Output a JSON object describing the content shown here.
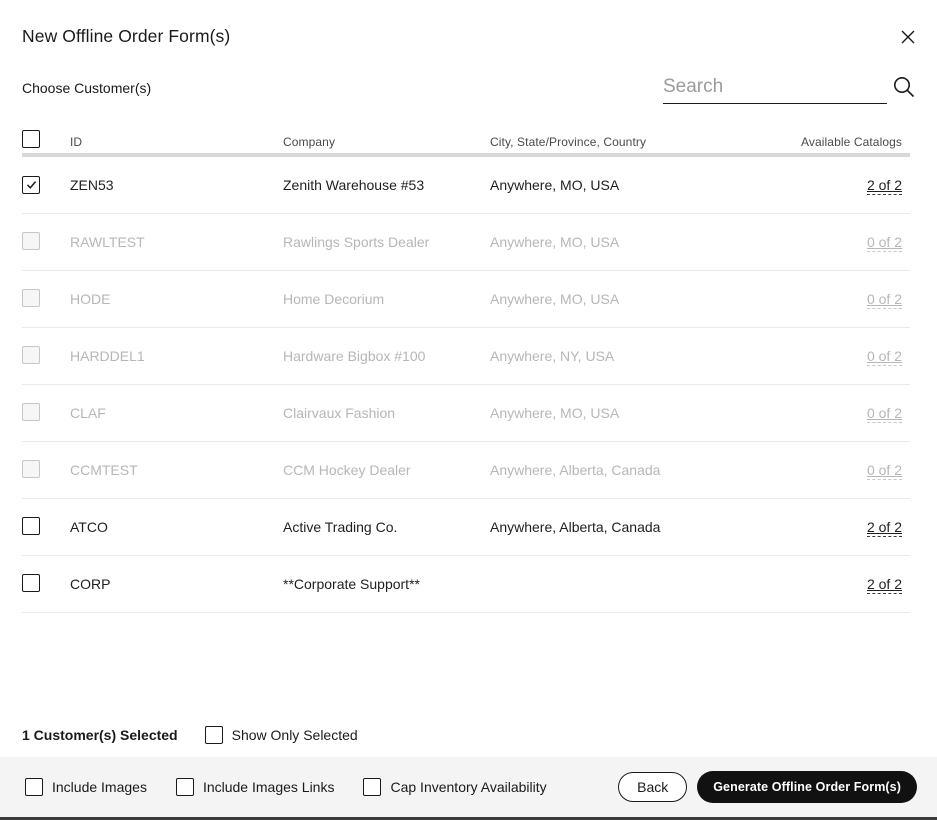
{
  "modal": {
    "title": "New Offline Order Form(s)"
  },
  "choose_label": "Choose Customer(s)",
  "search": {
    "placeholder": "Search"
  },
  "table": {
    "headers": {
      "id": "ID",
      "company": "Company",
      "city": "City, State/Province, Country",
      "catalogs": "Available Catalogs"
    },
    "rows": [
      {
        "id": "ZEN53",
        "company": "Zenith Warehouse #53",
        "city": "Anywhere, MO, USA",
        "catalogs": "2 of 2",
        "checked": true,
        "disabled": false
      },
      {
        "id": "RAWLTEST",
        "company": "Rawlings Sports Dealer",
        "city": "Anywhere, MO, USA",
        "catalogs": "0 of 2",
        "checked": false,
        "disabled": true
      },
      {
        "id": "HODE",
        "company": "Home Decorium",
        "city": "Anywhere, MO, USA",
        "catalogs": "0 of 2",
        "checked": false,
        "disabled": true
      },
      {
        "id": "HARDDEL1",
        "company": "Hardware Bigbox #100",
        "city": "Anywhere, NY, USA",
        "catalogs": "0 of 2",
        "checked": false,
        "disabled": true
      },
      {
        "id": "CLAF",
        "company": "Clairvaux Fashion",
        "city": "Anywhere, MO, USA",
        "catalogs": "0 of 2",
        "checked": false,
        "disabled": true
      },
      {
        "id": "CCMTEST",
        "company": "CCM Hockey Dealer",
        "city": "Anywhere, Alberta, Canada",
        "catalogs": "0 of 2",
        "checked": false,
        "disabled": true
      },
      {
        "id": "ATCO",
        "company": "Active Trading Co.",
        "city": "Anywhere, Alberta, Canada",
        "catalogs": "2 of 2",
        "checked": false,
        "disabled": false
      },
      {
        "id": "CORP",
        "company": "**Corporate Support**",
        "city": "",
        "catalogs": "2 of 2",
        "checked": false,
        "disabled": false
      }
    ]
  },
  "selection": {
    "count_label": "1 Customer(s) Selected",
    "show_only_label": "Show Only Selected",
    "show_only_checked": false
  },
  "action_bar": {
    "options": [
      {
        "label": "Include Images",
        "checked": false
      },
      {
        "label": "Include Images Links",
        "checked": false
      },
      {
        "label": "Cap Inventory Availability",
        "checked": false
      }
    ],
    "back_label": "Back",
    "generate_label": "Generate Offline Order Form(s)"
  },
  "colors": {
    "text": "#201f1e",
    "disabled_text": "#b9b6b4",
    "header_text": "#4c4a48",
    "row_divider": "#e9e9e9",
    "header_divider": "#d8d8d8",
    "bar_background": "#f5f4f4",
    "bar_bottom_border": "#3b3b3b",
    "primary_button_background": "#111111",
    "primary_button_text": "#ffffff"
  }
}
